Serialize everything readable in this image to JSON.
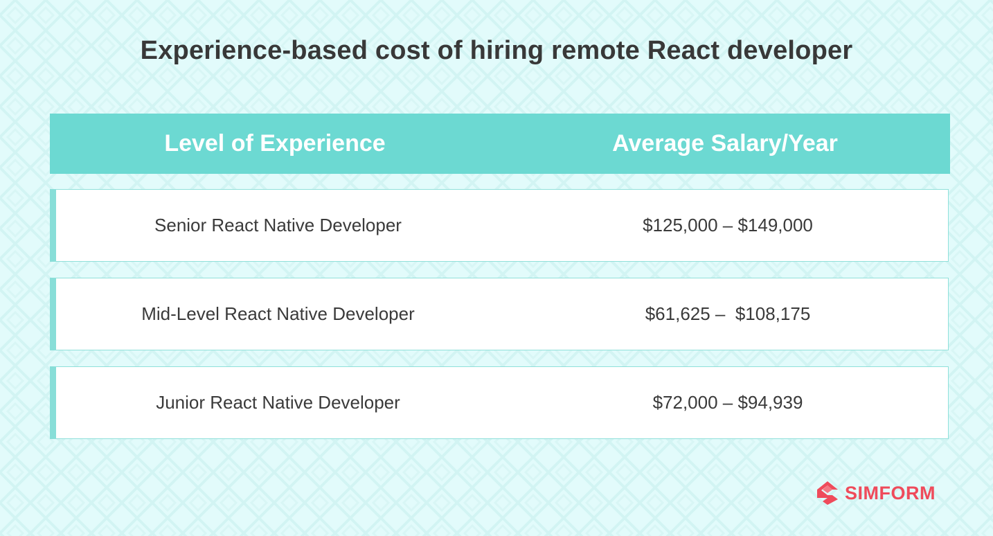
{
  "title": "Experience-based cost of hiring remote React developer",
  "table": {
    "headers": [
      "Level of Experience",
      "Average Salary/Year"
    ],
    "rows": [
      {
        "level": "Senior React Native Developer",
        "salary": "$125,000 – $149,000"
      },
      {
        "level": "Mid-Level React Native Developer",
        "salary": "$61,625 –  $108,175"
      },
      {
        "level": "Junior React Native Developer",
        "salary": "$72,000 – $94,939"
      }
    ]
  },
  "brand": {
    "name": "SIMFORM",
    "icon": "simform-logo-icon",
    "color": "#ef4b5b"
  },
  "colors": {
    "header_bg": "#6cd9d2",
    "row_accent": "#88ded8",
    "background": "#e2fbfb"
  }
}
